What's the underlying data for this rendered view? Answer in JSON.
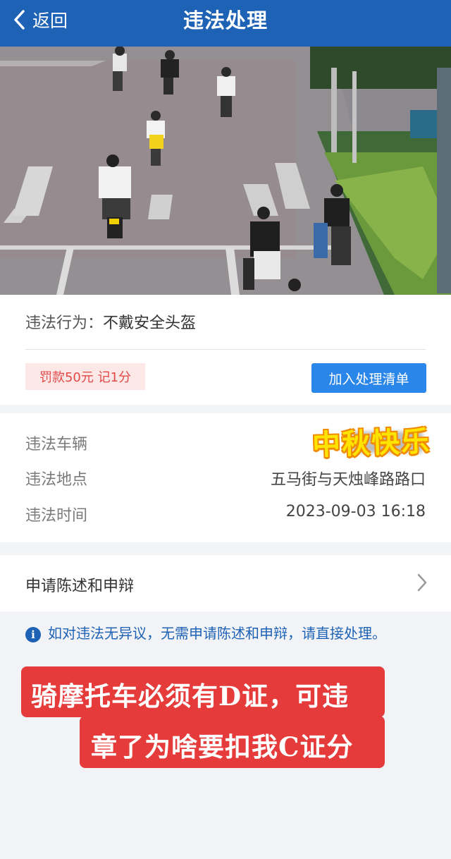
{
  "header": {
    "back_label": "返回",
    "title": "违法处理"
  },
  "photo": {
    "description_icon": "traffic-camera-photo"
  },
  "violation": {
    "behavior_label": "违法行为：",
    "behavior_value": "不戴安全头盔",
    "fine_tag": "罚款50元 记1分",
    "add_button": "加入处理清单"
  },
  "details": {
    "vehicle_label": "违法车辆",
    "location_label": "违法地点",
    "location_value": "五马街与天烛峰路路口",
    "time_label": "违法时间",
    "time_value": "2023-09-03 16:18"
  },
  "sticker": {
    "text": "中秋快乐"
  },
  "appeal": {
    "label": "申请陈述和申辩"
  },
  "info": {
    "text": "如对违法无异议，无需申请陈述和申辩，请直接处理。"
  },
  "overlay": {
    "line1": "骑摩托车必须有D证，可违",
    "line2": "章了为啥要扣我C证分"
  },
  "colors": {
    "header": "#1d62b4",
    "button": "#2a86e8",
    "fine": "#e24848",
    "banner": "#e63b3b"
  }
}
